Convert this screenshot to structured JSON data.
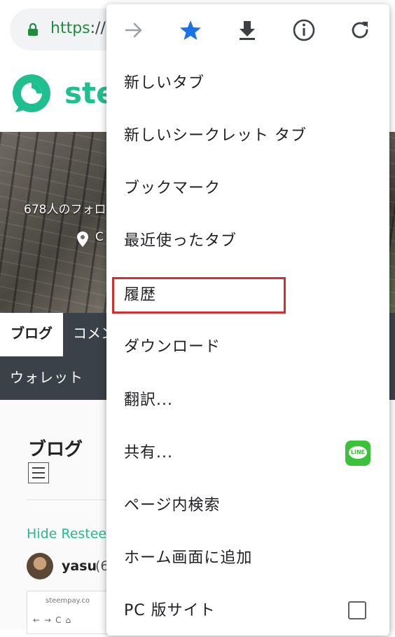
{
  "browser": {
    "url_scheme": "https",
    "url_rest": "://"
  },
  "site": {
    "logo_text": "ste"
  },
  "profile": {
    "followers_text": "678人のフォロ",
    "location_text": "C"
  },
  "profile_tabs": {
    "blog": "ブログ",
    "comments": "コメン",
    "wallet": "ウォレット"
  },
  "content": {
    "heading": "ブログ",
    "hide_resteems": "Hide Restee",
    "author": "yasu",
    "author_rep": "(6",
    "thumb_url": "steempay.co",
    "thumb_nav": "←→C⌂"
  },
  "menu": {
    "icons": [
      "forward-icon",
      "bookmark-star-icon",
      "download-icon",
      "info-icon",
      "refresh-icon"
    ],
    "items": [
      {
        "label": "新しいタブ"
      },
      {
        "label": "新しいシークレット タブ"
      },
      {
        "label": "ブックマーク"
      },
      {
        "label": "最近使ったタブ"
      },
      {
        "label": "履歴"
      },
      {
        "label": "ダウンロード"
      },
      {
        "label": "翻訳..."
      },
      {
        "label": "共有..."
      },
      {
        "label": "ページ内検索"
      },
      {
        "label": "ホーム画面に追加"
      },
      {
        "label": "PC 版サイト"
      }
    ],
    "share_badge": "LINE",
    "highlight_color": "#d32f2f",
    "star_color": "#1a73e8"
  },
  "colors": {
    "steem_green": "#1fbf8f",
    "tabbar_bg": "#3a4148"
  }
}
